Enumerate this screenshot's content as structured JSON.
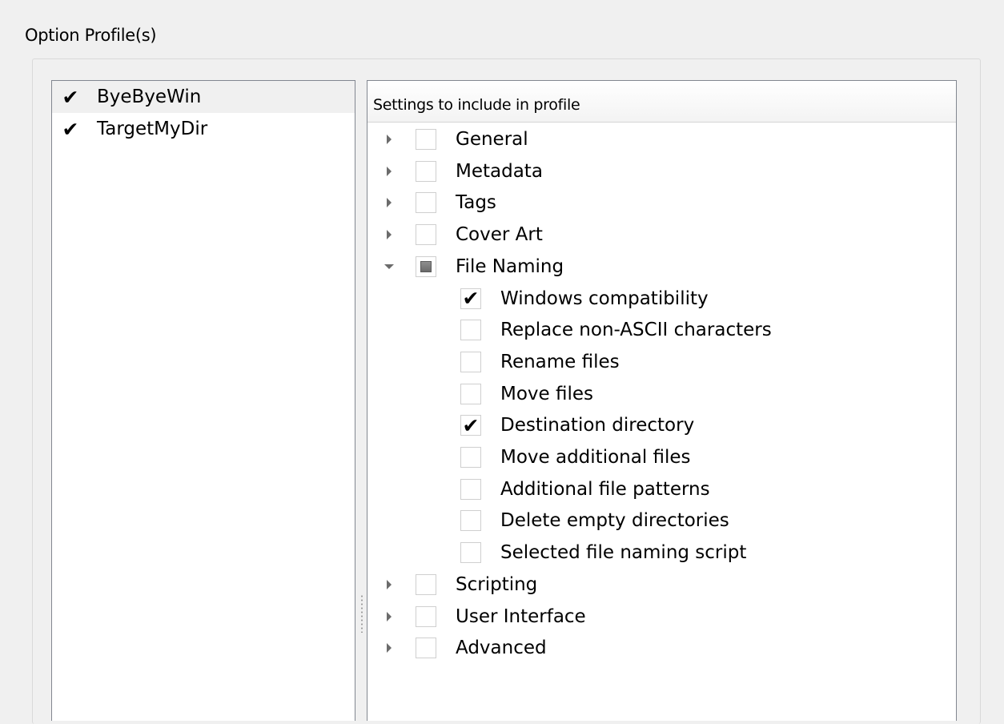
{
  "group": {
    "title": "Option Profile(s)"
  },
  "profiles": [
    {
      "label": "ByeByeWin",
      "checked": true,
      "selected": true
    },
    {
      "label": "TargetMyDir",
      "checked": true,
      "selected": false
    }
  ],
  "settings_tree": {
    "header": "Settings to include in profile",
    "categories": [
      {
        "label": "General",
        "state": "unchecked",
        "expanded": false
      },
      {
        "label": "Metadata",
        "state": "unchecked",
        "expanded": false
      },
      {
        "label": "Tags",
        "state": "unchecked",
        "expanded": false
      },
      {
        "label": "Cover Art",
        "state": "unchecked",
        "expanded": false
      },
      {
        "label": "File Naming",
        "state": "partial",
        "expanded": true,
        "children": [
          {
            "label": "Windows compatibility",
            "checked": true
          },
          {
            "label": "Replace non-ASCII characters",
            "checked": false
          },
          {
            "label": "Rename files",
            "checked": false
          },
          {
            "label": "Move files",
            "checked": false
          },
          {
            "label": "Destination directory",
            "checked": true
          },
          {
            "label": "Move additional files",
            "checked": false
          },
          {
            "label": "Additional file patterns",
            "checked": false
          },
          {
            "label": "Delete empty directories",
            "checked": false
          },
          {
            "label": "Selected file naming script",
            "checked": false
          }
        ]
      },
      {
        "label": "Scripting",
        "state": "unchecked",
        "expanded": false
      },
      {
        "label": "User Interface",
        "state": "unchecked",
        "expanded": false
      },
      {
        "label": "Advanced",
        "state": "unchecked",
        "expanded": false
      }
    ]
  },
  "check_mark_glyph": "✔"
}
